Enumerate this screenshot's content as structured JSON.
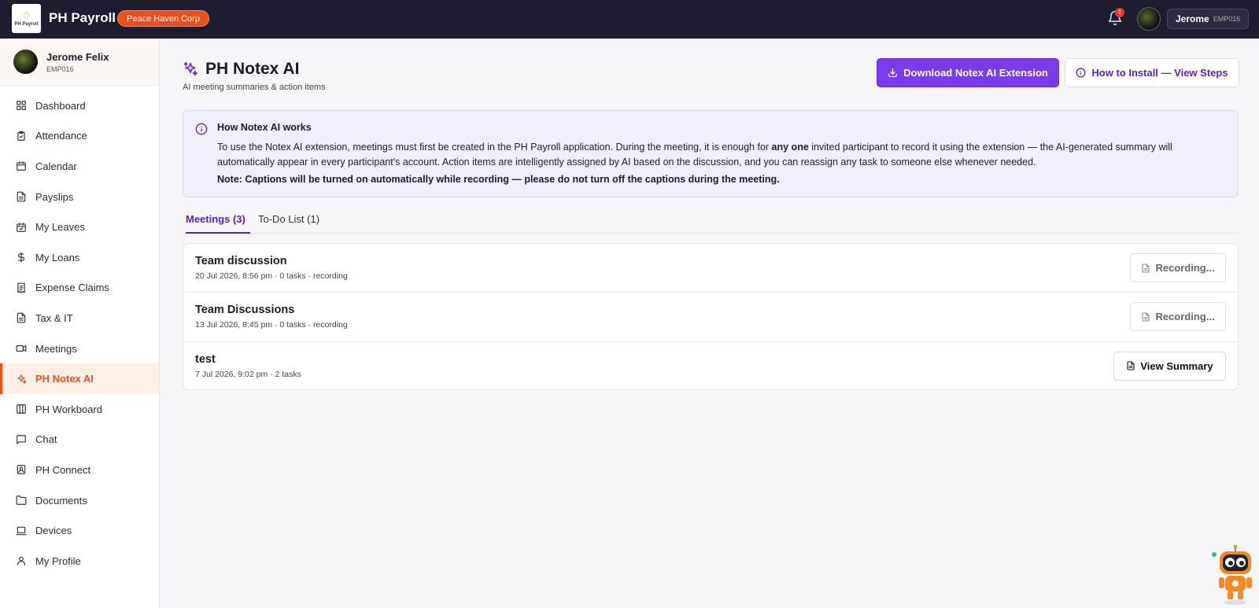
{
  "topbar": {
    "logo_text": "PH Payroll",
    "app_name": "PH Payroll",
    "org_badge": "Peace Haven Corp",
    "notification_count": "1",
    "user_name": "Jerome",
    "user_id": "EMP016"
  },
  "sidebar": {
    "user_name": "Jerome Felix",
    "user_id": "EMP016",
    "items": [
      {
        "label": "Dashboard",
        "icon": "dashboard-icon"
      },
      {
        "label": "Attendance",
        "icon": "clipboard-check-icon"
      },
      {
        "label": "Calendar",
        "icon": "calendar-icon"
      },
      {
        "label": "Payslips",
        "icon": "document-icon"
      },
      {
        "label": "My Leaves",
        "icon": "calendar-check-icon"
      },
      {
        "label": "My Loans",
        "icon": "dollar-icon"
      },
      {
        "label": "Expense Claims",
        "icon": "receipt-icon"
      },
      {
        "label": "Tax & IT",
        "icon": "document-icon"
      },
      {
        "label": "Meetings",
        "icon": "video-icon"
      },
      {
        "label": "PH Notex AI",
        "icon": "sparkles-icon",
        "active": true
      },
      {
        "label": "PH Workboard",
        "icon": "board-icon"
      },
      {
        "label": "Chat",
        "icon": "chat-icon"
      },
      {
        "label": "PH Connect",
        "icon": "contacts-icon"
      },
      {
        "label": "Documents",
        "icon": "folder-icon"
      },
      {
        "label": "Devices",
        "icon": "laptop-icon"
      },
      {
        "label": "My Profile",
        "icon": "user-icon"
      }
    ]
  },
  "page": {
    "title": "PH Notex AI",
    "subtitle": "AI meeting summaries & action items",
    "download_button": "Download Notex AI Extension",
    "howto_button": "How to Install — View Steps"
  },
  "info": {
    "title": "How Notex AI works",
    "body_part1": "To use the Notex AI extension, meetings must first be created in the PH Payroll application. During the meeting, it is enough for ",
    "body_bold": "any one",
    "body_part2": " invited participant to record it using the extension — the AI-generated summary will automatically appear in every participant's account. Action items are intelligently assigned by AI based on the discussion, and you can reassign any task to someone else whenever needed.",
    "note": "Note: Captions will be turned on automatically while recording — please do not turn off the captions during the meeting."
  },
  "tabs": {
    "meetings": "Meetings (3)",
    "todo": "To-Do List (1)"
  },
  "meetings": [
    {
      "title": "Team discussion",
      "meta": "20 Jul 2026, 8:56 pm · 0 tasks · recording",
      "action": "Recording..."
    },
    {
      "title": "Team Discussions",
      "meta": "13 Jul 2026, 8:45 pm · 0 tasks · recording",
      "action": "Recording..."
    },
    {
      "title": "test",
      "meta": "7 Jul 2026, 9:02 pm · 2 tasks",
      "action": "View Summary"
    }
  ],
  "colors": {
    "accent": "#7c3aed",
    "brand_orange": "#e8501c",
    "topbar": "#1e1d2f"
  }
}
